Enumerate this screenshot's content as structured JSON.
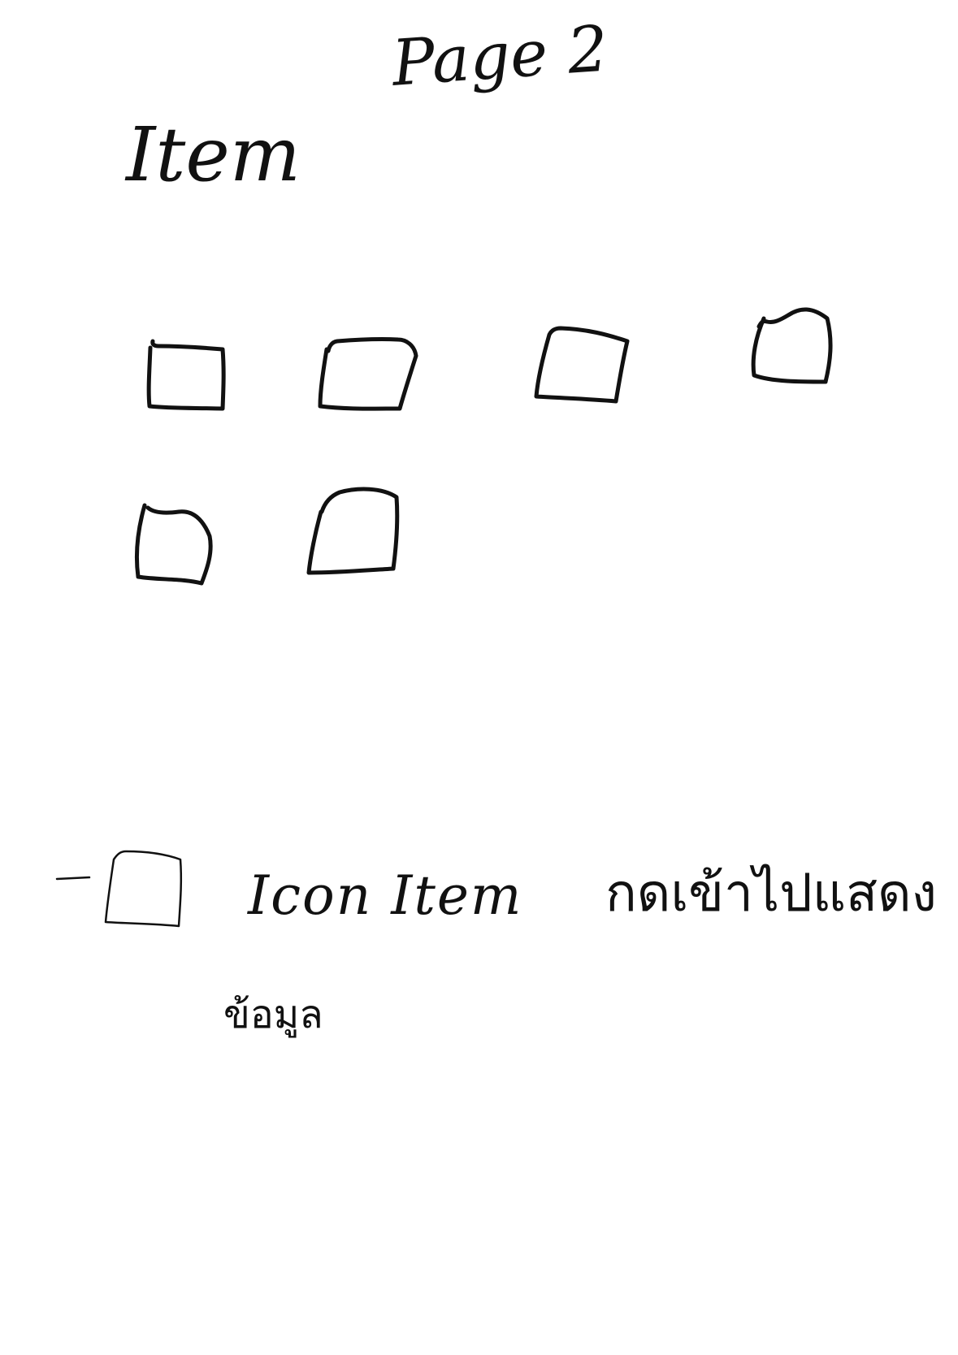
{
  "page": {
    "title": "Page 2"
  },
  "items_section": {
    "title": "Item",
    "item_count": 6
  },
  "note": {
    "dash": "-",
    "text_en": "Icon Item",
    "text_th_line1": "กดเข้าไปแสดง",
    "text_th_line2": "ข้อมูล"
  },
  "colors": {
    "background": "#ffffff",
    "ink": "#111111"
  }
}
